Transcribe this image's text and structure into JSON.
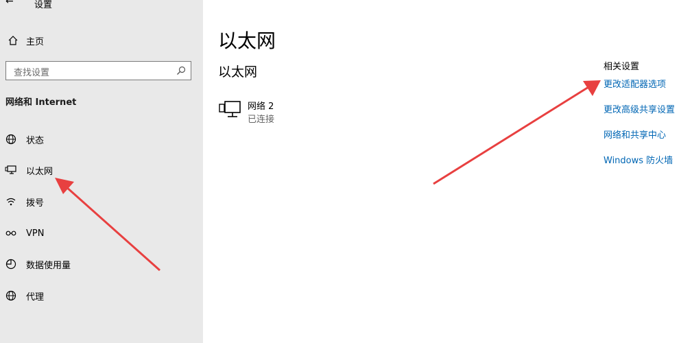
{
  "window": {
    "title": "设置",
    "back_glyph": "←"
  },
  "sidebar": {
    "home_label": "主页",
    "search_placeholder": "查找设置",
    "section_title": "网络和 Internet",
    "items": [
      {
        "label": "状态",
        "icon": "globe-status-icon"
      },
      {
        "label": "以太网",
        "icon": "ethernet-monitor-icon"
      },
      {
        "label": "拨号",
        "icon": "dialup-icon"
      },
      {
        "label": "VPN",
        "icon": "vpn-icon"
      },
      {
        "label": "数据使用量",
        "icon": "data-usage-icon"
      },
      {
        "label": "代理",
        "icon": "proxy-globe-icon"
      }
    ]
  },
  "main": {
    "title": "以太网",
    "subtitle": "以太网",
    "network": {
      "name": "网络 2",
      "status": "已连接",
      "icon": "ethernet-network-icon"
    }
  },
  "related": {
    "title": "相关设置",
    "links": [
      "更改适配器选项",
      "更改高级共享设置",
      "网络和共享中心",
      "Windows 防火墙"
    ]
  },
  "colors": {
    "sidebar_bg": "#e9e9e9",
    "link": "#0066b4",
    "annotation_arrow": "#e84040"
  }
}
